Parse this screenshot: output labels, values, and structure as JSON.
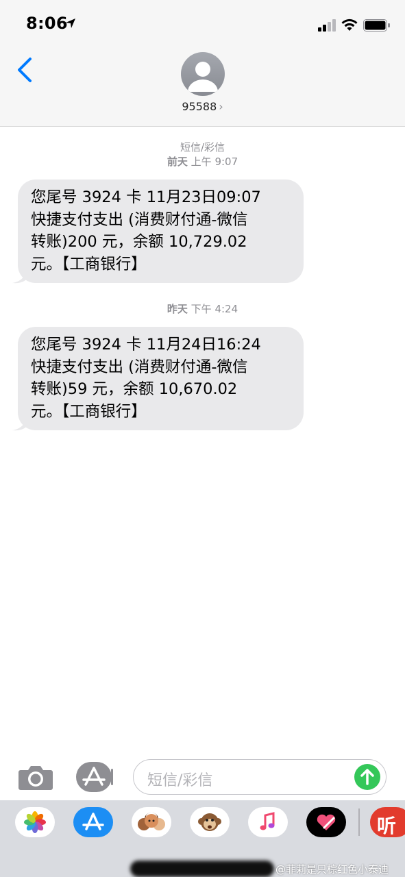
{
  "status_bar": {
    "time": "8:06"
  },
  "header": {
    "contact": "95588",
    "chevron": "›"
  },
  "conversation": [
    {
      "service": "短信/彩信",
      "day": "前天",
      "time": "上午 9:07",
      "message": "您尾号 3924 卡 11月23日09:07\n快捷支付支出 (消费财付通-微信\n转账)200 元，余额 10,729.02\n元。【工商银行】"
    },
    {
      "day": "昨天",
      "time": "下午 4:24",
      "message": "您尾号 3924 卡 11月24日16:24\n快捷支付支出 (消费财付通-微信\n转账)59 元，余额 10,670.02\n元。【工商银行】"
    }
  ],
  "input": {
    "placeholder": "短信/彩信"
  },
  "drawer": {
    "apps": [
      "photos-icon",
      "app-store-icon",
      "memoji-icon",
      "animoji-monkey-icon",
      "music-icon",
      "digital-touch-icon",
      "ting-icon"
    ],
    "last_app_label": "听"
  },
  "watermark": "@菲莉是只棕红色小泰迪",
  "colors": {
    "accent": "#007aff",
    "bubble": "#e9e9eb",
    "send": "#34c759",
    "timestamp": "#8e8e93"
  }
}
